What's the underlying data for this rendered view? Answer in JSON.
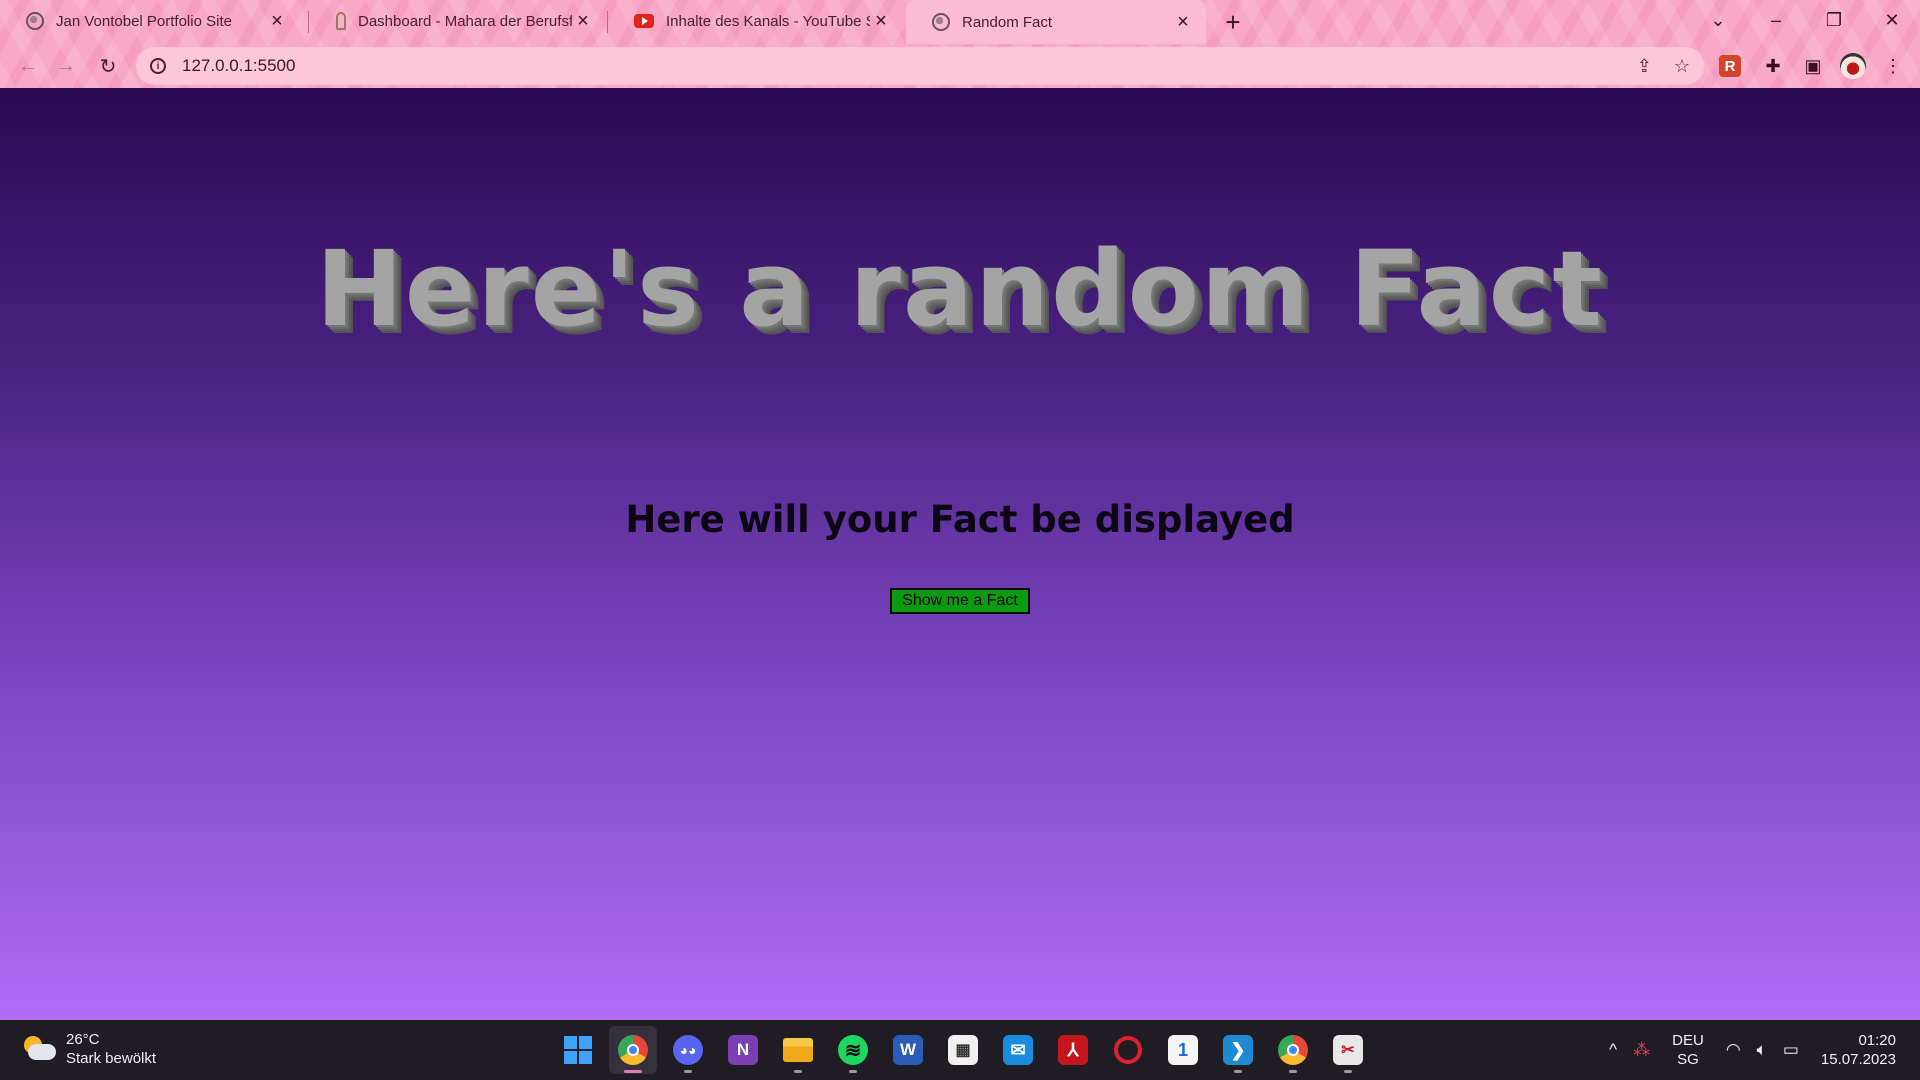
{
  "browser": {
    "tabs": [
      {
        "title": "Jan Vontobel Portfolio Site",
        "icon": "globe-icon",
        "active": false
      },
      {
        "title": "Dashboard - Mahara der Berufsfa",
        "icon": "mahara-icon",
        "active": false
      },
      {
        "title": "Inhalte des Kanals - YouTube Stu",
        "icon": "youtube-icon",
        "active": false
      },
      {
        "title": "Random Fact",
        "icon": "globe-icon",
        "active": true
      }
    ],
    "url": "127.0.0.1:5500",
    "theme_color": "#f7a9c6"
  },
  "page": {
    "heading": "Here's a random Fact",
    "fact_text": "Here will your Fact be displayed",
    "button_label": "Show me a Fact",
    "button_color": "#0c9a10",
    "gradient_top": "#2a0a52",
    "gradient_bottom": "#b26cf6"
  },
  "taskbar": {
    "weather": {
      "temp": "26°C",
      "condition": "Stark bewölkt"
    },
    "apps": [
      "windows-start",
      "chrome",
      "discord",
      "onenote",
      "file-explorer",
      "spotify",
      "word",
      "microsoft-store",
      "mail",
      "acrobat",
      "opera",
      "one-password",
      "vscode",
      "chrome-2",
      "snipping-tool"
    ],
    "language": {
      "line1": "DEU",
      "line2": "SG"
    },
    "clock": {
      "time": "01:20",
      "date": "15.07.2023"
    }
  }
}
